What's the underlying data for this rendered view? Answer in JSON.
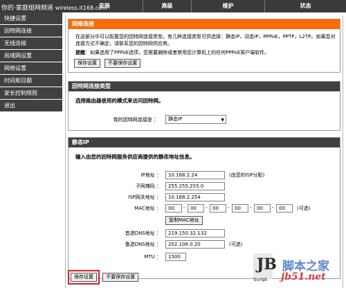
{
  "watermark_top": {
    "text": "你的·家庭组网频道",
    "url": "wireless.it168.com"
  },
  "nav_tabs": [
    {
      "label": "安装"
    },
    {
      "label": "高级"
    },
    {
      "label": "维护"
    },
    {
      "label": "状态"
    }
  ],
  "sidebar": {
    "items": [
      {
        "label": "快捷设置"
      },
      {
        "label": "因特网连接"
      },
      {
        "label": "无线连接"
      },
      {
        "label": "局域网设置"
      },
      {
        "label": "网络设置"
      },
      {
        "label": "时间和日期"
      },
      {
        "label": "家长控制规则"
      },
      {
        "label": "退出"
      }
    ]
  },
  "network_panel": {
    "title": "网络连接",
    "intro": "在这部分中可以配置您的因特网连接类型。有几种连接类型可供选择：静态IP，动态IP，PPPoE，PPTP，L2TP。如果您对连接方式不确定，请联系您的因特网供应商。",
    "note_label": "提醒",
    "note_text": "：如果选用了PPPoE选项，您需要删除或者禁用您计算机上的任何PPPoE客户端软件。",
    "save_label": "保存设置",
    "nosave_label": "不要保存设置"
  },
  "conn_type_panel": {
    "title": "因特网连接类型",
    "subtitle": "选择路由器使用的模式来访问因特网。",
    "label": "我的因特网连接是 ：",
    "selected": "静态IP"
  },
  "static_panel": {
    "title": "静态IP",
    "subtitle": "输入由您的因特网服务供应商提供的静态地址信息。",
    "ip_label": "IP地址 ：",
    "ip_value": "10.168.2.24",
    "ip_hint": "(由您的ISP分配)",
    "mask_label": "子网掩码 ：",
    "mask_value": "255.255.255.0",
    "gateway_label": "ISP网关地址 ：",
    "gateway_value": "10.168.2.254",
    "mac_label": "MAC地址 ：",
    "mac_values": [
      "00",
      "00",
      "00",
      "00",
      "00",
      "00"
    ],
    "optional_hint": "(可选)",
    "clone_mac_label": "复制MAC地址",
    "dns1_label": "首选DNS地址 ：",
    "dns1_value": "219.150.32.132",
    "dns2_label": "备选DNS地址 ：",
    "dns2_value": "202.106.0.20",
    "mtu_label": "MTU ：",
    "mtu_value": "1500"
  },
  "bottom": {
    "save_label": "保存设置",
    "nosave_label": "不要保存设置"
  },
  "watermark": {
    "logo_text": "JB",
    "script_text": "Script",
    "cn_text": "脚本之家",
    "site_text": "jb51.net"
  },
  "colors": {
    "accent": "#ff6a00",
    "header": "#404040",
    "highlight": "#d4202a"
  }
}
